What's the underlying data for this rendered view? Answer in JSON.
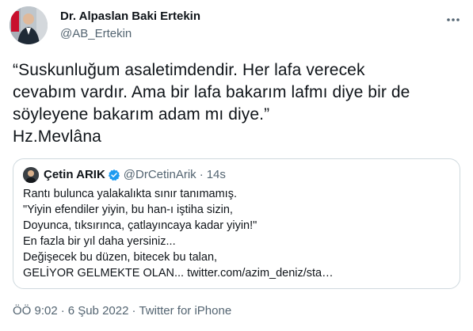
{
  "author": {
    "name": "Dr. Alpaslan Baki Ertekin",
    "handle": "@AB_Ertekin"
  },
  "tweet": {
    "lines": [
      "“Suskunluğum asaletimdendir. Her lafa verecek",
      "cevabım vardır. Ama bir lafa bakarım lafmı diye bir de",
      "söyleyene bakarım adam mı diye.”",
      "Hz.Mevlâna"
    ]
  },
  "quoted": {
    "name": "Çetin ARIK",
    "handle": "@DrCetinArik",
    "separator": "·",
    "time": "14s",
    "lines": [
      "Rantı bulunca yalakalıkta sınır tanımamış.",
      "\"Yiyin efendiler yiyin, bu han-ı iştiha sizin,",
      "Doyunca, tıksırınca, çatlayıncaya kadar yiyin!\"",
      "En fazla bir yıl daha yersiniz...",
      "Değişecek bu düzen, bitecek bu talan,",
      "GELİYOR GELMEKTE OLAN... twitter.com/azim_deniz/sta…"
    ]
  },
  "meta": {
    "time": "ÖÖ 9:02",
    "separator": "·",
    "date": "6 Şub 2022",
    "source": "Twitter for iPhone"
  },
  "icons": {
    "more": "more-horizontal-icon",
    "verified": "verified-badge-icon"
  },
  "colors": {
    "text": "#0f1419",
    "secondary": "#536471",
    "verified": "#1d9bf0",
    "border": "#cfd9de"
  }
}
